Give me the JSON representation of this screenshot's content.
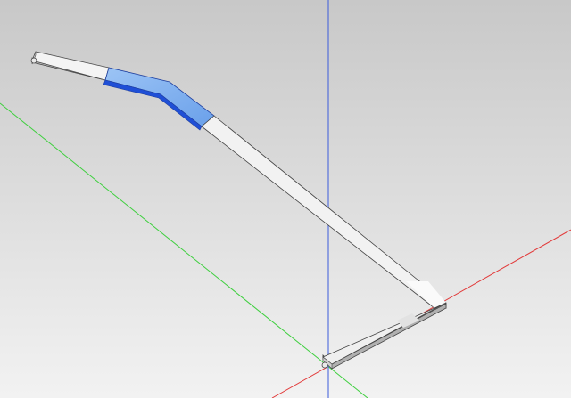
{
  "viewport": {
    "background_top": "#c8c8c8",
    "background_bottom": "#f2f2f2"
  },
  "axes": [
    {
      "name": "x",
      "color": "#e23a3a"
    },
    {
      "name": "y",
      "color": "#3ecf3e"
    },
    {
      "name": "z",
      "color": "#3b5bdb"
    }
  ],
  "model": {
    "type": "bent-bar",
    "segment_count": 4,
    "selected_segment_index": 1,
    "selection_color": "#1f4fd6",
    "selection_highlight_color": "#7fb0f0",
    "face_color": "#f4f4f4",
    "side_color": "#b8b8b8",
    "edge_color": "#444444"
  }
}
